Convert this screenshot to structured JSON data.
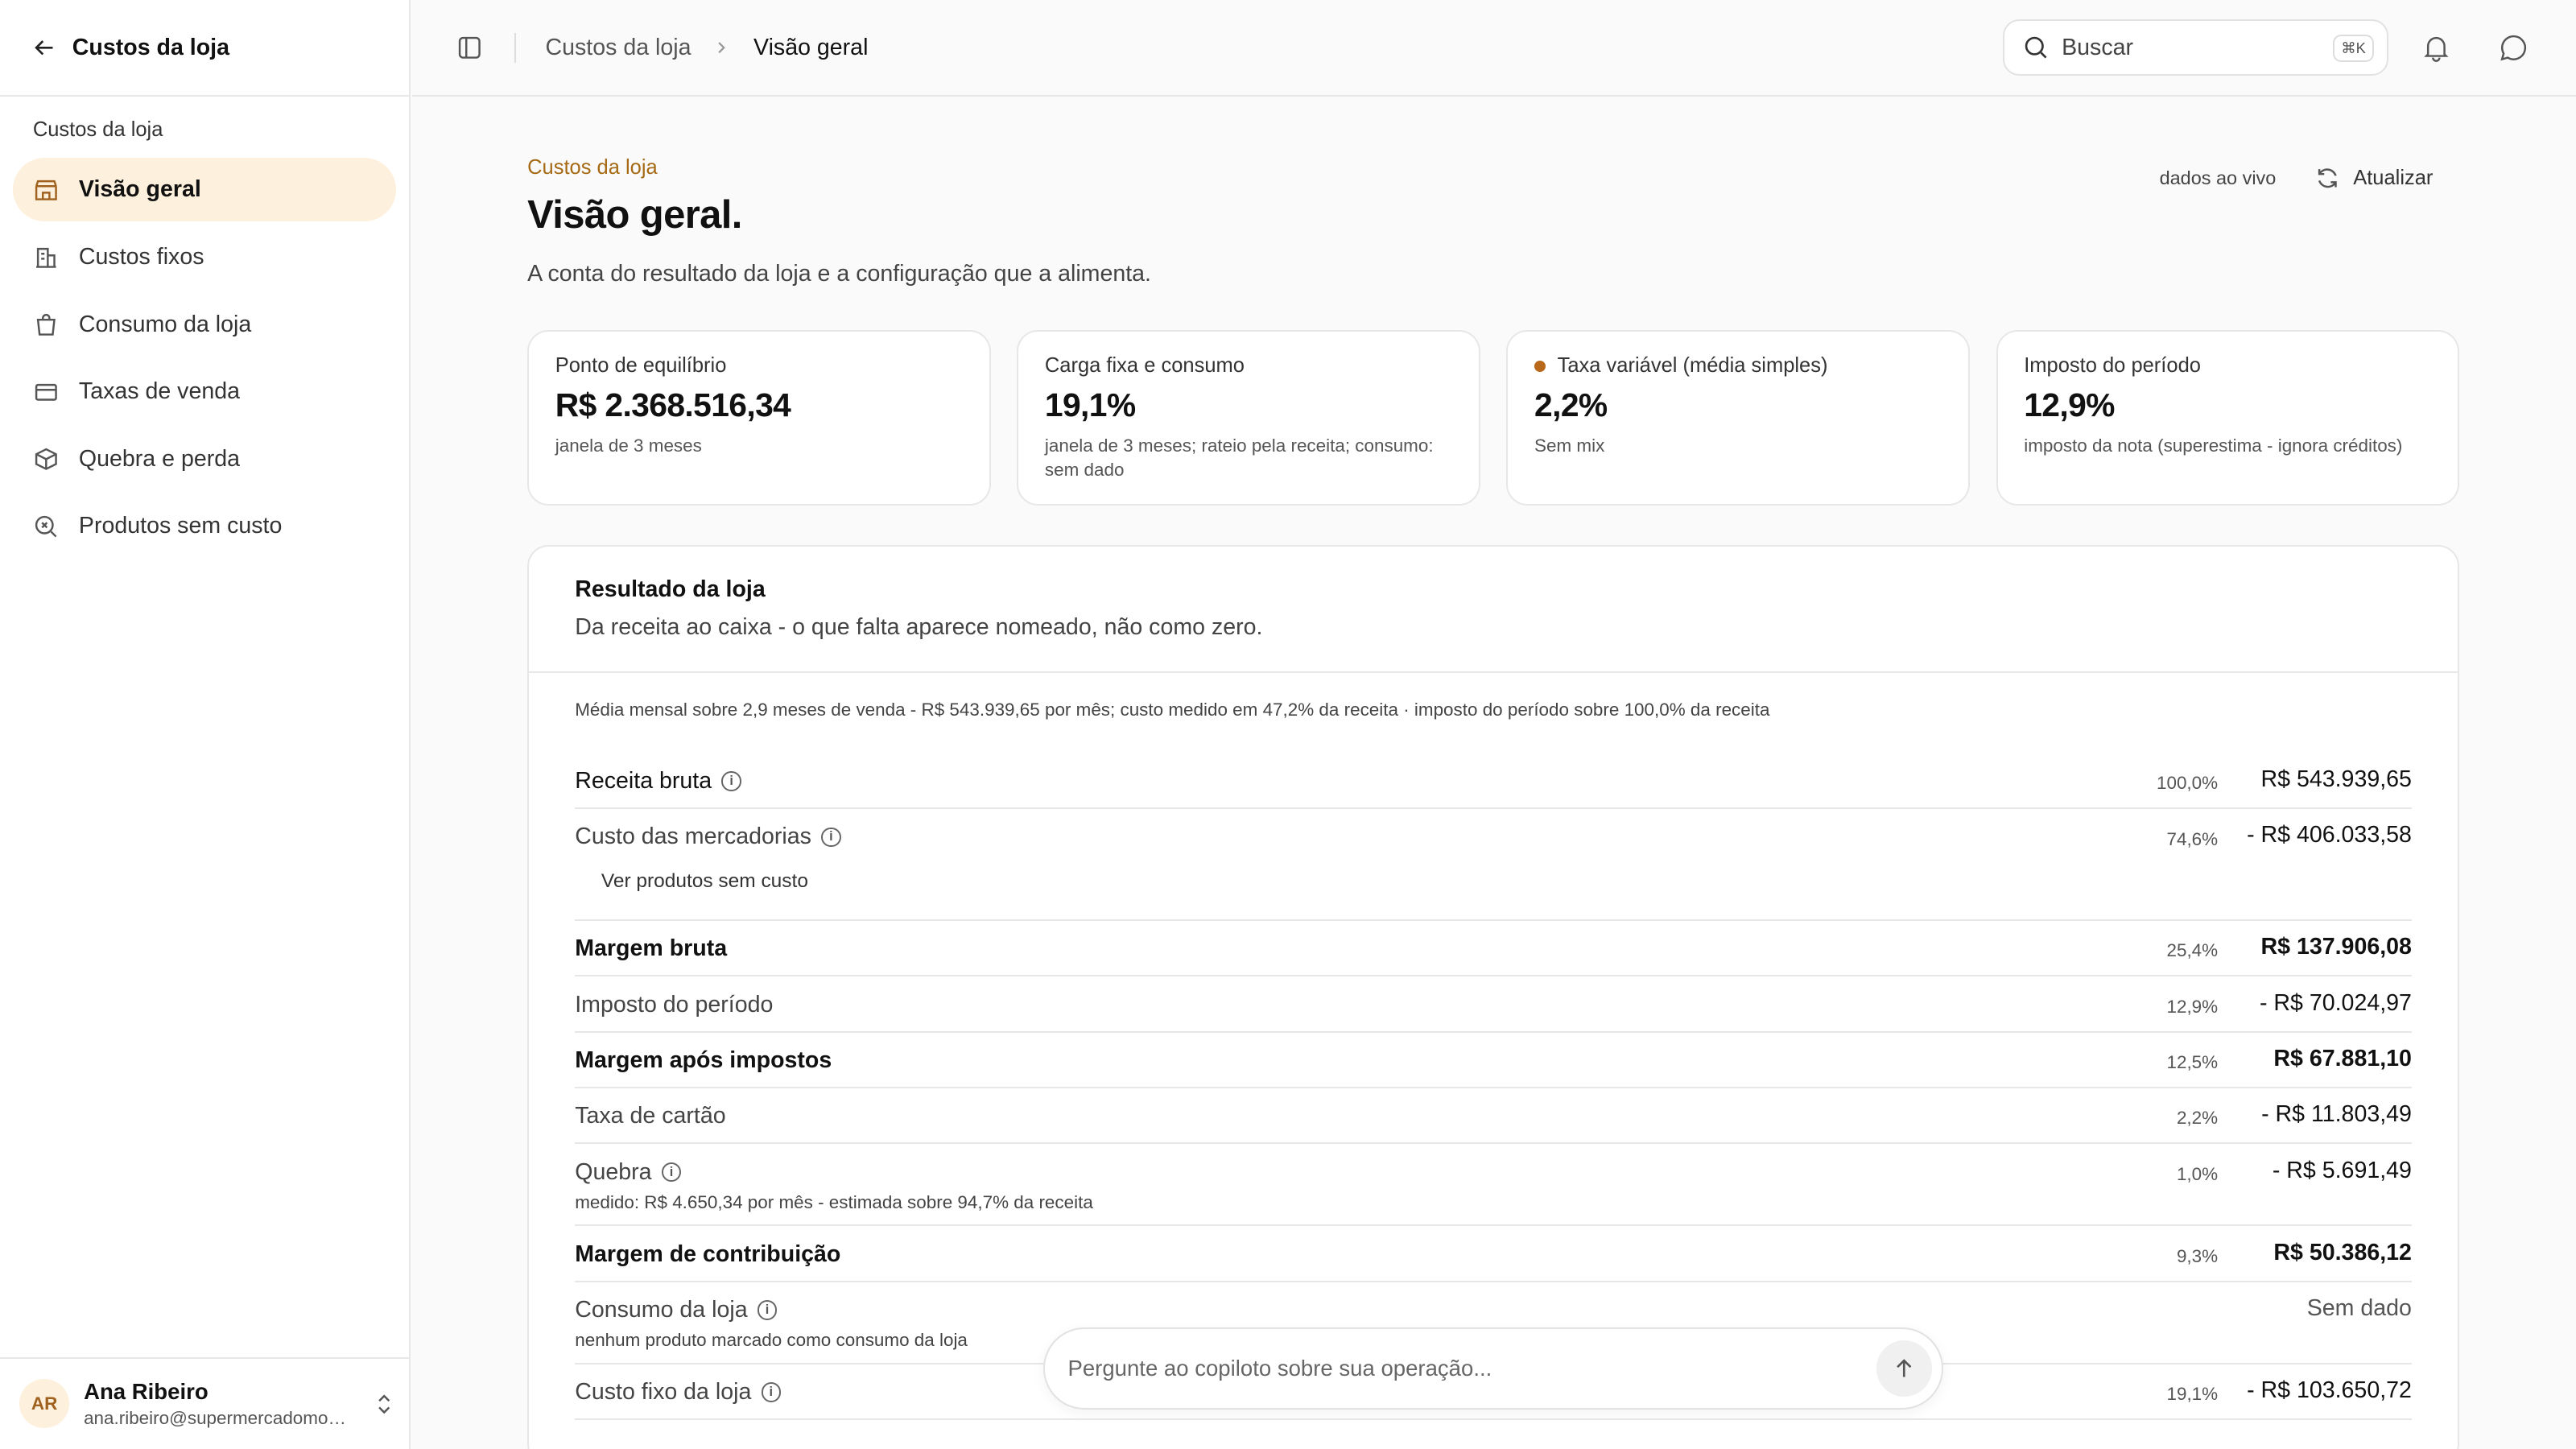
{
  "sidebar": {
    "back_title": "Custos da loja",
    "group_label": "Custos da loja",
    "items": [
      {
        "label": "Visão geral",
        "icon": "store-icon"
      },
      {
        "label": "Custos fixos",
        "icon": "building-icon"
      },
      {
        "label": "Consumo da loja",
        "icon": "bag-icon"
      },
      {
        "label": "Taxas de venda",
        "icon": "card-icon"
      },
      {
        "label": "Quebra e perda",
        "icon": "box-icon"
      },
      {
        "label": "Produtos sem custo",
        "icon": "search-x-icon"
      }
    ],
    "user": {
      "initials": "AR",
      "name": "Ana Ribeiro",
      "email": "ana.ribeiro@supermercadomodelo.com.br"
    }
  },
  "topbar": {
    "breadcrumb": [
      "Custos da loja",
      "Visão geral"
    ],
    "search_placeholder": "Buscar",
    "shortcut": "⌘K"
  },
  "header": {
    "kicker": "Custos da loja",
    "title": "Visão geral.",
    "description": "A conta do resultado da loja e a configuração que a alimenta.",
    "live": "dados ao vivo",
    "refresh": "Atualizar"
  },
  "cards": [
    {
      "label": "Ponto de equilíbrio",
      "value": "R$ 2.368.516,34",
      "sub": "janela de 3 meses"
    },
    {
      "label": "Carga fixa e consumo",
      "value": "19,1%",
      "sub": "janela de 3 meses; rateio pela receita; consumo: sem dado"
    },
    {
      "label": "Taxa variável (média simples)",
      "value": "2,2%",
      "sub": "Sem mix"
    },
    {
      "label": "Imposto do período",
      "value": "12,9%",
      "sub": "imposto da nota (superestima - ignora créditos)"
    }
  ],
  "result": {
    "title": "Resultado da loja",
    "subtitle": "Da receita ao caixa - o que falta aparece nomeado, não como zero.",
    "note": "Média mensal sobre 2,9 meses de venda - R$ 543.939,65 por mês; custo medido em 47,2% da receita · imposto do período sobre 100,0% da receita",
    "link": "Ver produtos sem custo",
    "rows": [
      {
        "name": "Receita bruta",
        "pct": "100,0%",
        "amount": "R$ 543.939,65",
        "sub": ""
      },
      {
        "name": "Custo das mercadorias",
        "pct": "74,6%",
        "amount": "- R$ 406.033,58",
        "sub": ""
      },
      {
        "name": "Margem bruta",
        "pct": "25,4%",
        "amount": "R$ 137.906,08",
        "sub": ""
      },
      {
        "name": "Imposto do período",
        "pct": "12,9%",
        "amount": "- R$ 70.024,97",
        "sub": ""
      },
      {
        "name": "Margem após impostos",
        "pct": "12,5%",
        "amount": "R$ 67.881,10",
        "sub": ""
      },
      {
        "name": "Taxa de cartão",
        "pct": "2,2%",
        "amount": "- R$ 11.803,49",
        "sub": ""
      },
      {
        "name": "Quebra",
        "pct": "1,0%",
        "amount": "- R$ 5.691,49",
        "sub": "medido: R$ 4.650,34 por mês - estimada sobre 94,7% da receita"
      },
      {
        "name": "Margem de contribuição",
        "pct": "9,3%",
        "amount": "R$ 50.386,12",
        "sub": ""
      },
      {
        "name": "Consumo da loja",
        "pct": "",
        "amount": "Sem dado",
        "sub": "nenhum produto marcado como consumo da loja"
      },
      {
        "name": "Custo fixo da loja",
        "pct": "19,1%",
        "amount": "- R$ 103.650,72",
        "sub": ""
      }
    ]
  },
  "copilot": {
    "placeholder": "Pergunte ao copiloto sobre sua operação..."
  }
}
